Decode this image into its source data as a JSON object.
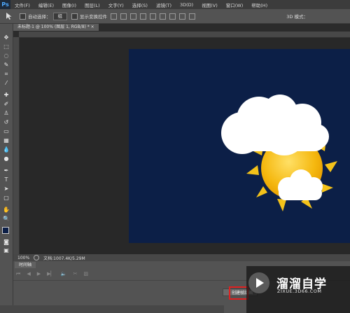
{
  "app": {
    "logo": "Ps"
  },
  "menu": [
    "文件(F)",
    "编辑(E)",
    "图像(I)",
    "图层(L)",
    "文字(Y)",
    "选择(S)",
    "滤镜(T)",
    "3D(D)",
    "视图(V)",
    "窗口(W)",
    "帮助(H)"
  ],
  "options": {
    "auto_select_label": "自动选择：",
    "auto_select_value": "组",
    "show_transform_label": "显示变换控件",
    "mode_3d_label": "3D 模式："
  },
  "document": {
    "tab_label": "未标题-1 @ 100% (图层 1, RGB/8) * ×",
    "zoom": "100%",
    "doc_size": "文档:1007.4K/5.29M"
  },
  "timeline": {
    "tab_label": "时间轴",
    "create_button_label": "创建帧动画"
  },
  "watermark": {
    "title": "溜溜自学",
    "url": "ZIXUE.3D66.COM"
  },
  "colors": {
    "canvas_background": "#0c1f47",
    "sun": "#f5b80f",
    "highlight_border": "#e02020"
  }
}
